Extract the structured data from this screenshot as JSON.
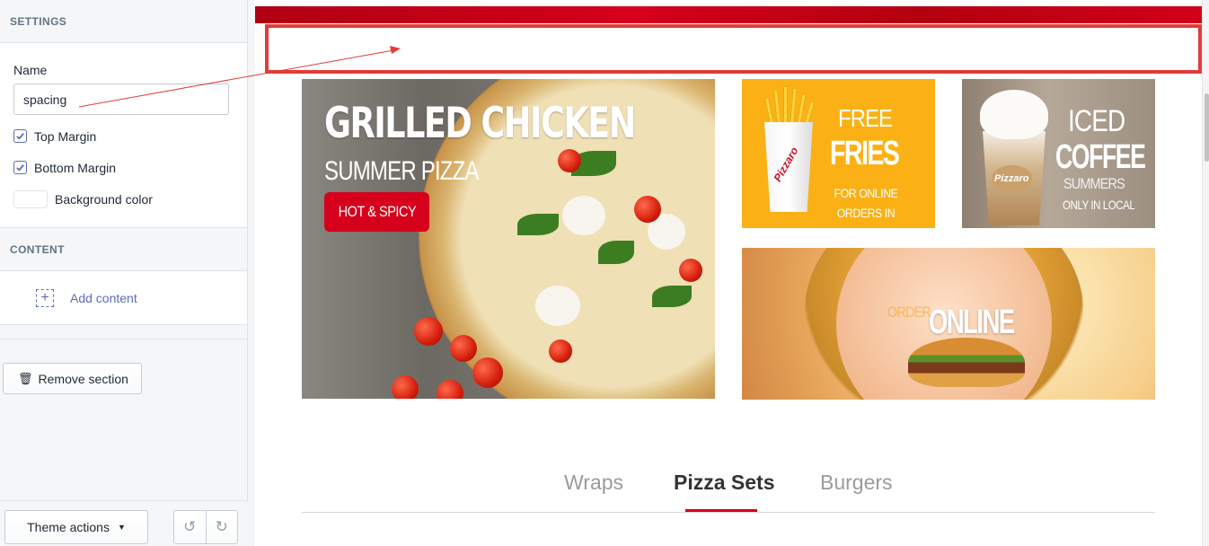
{
  "sidebar": {
    "settings_heading": "SETTINGS",
    "name_label": "Name",
    "name_value": "spacing",
    "top_margin_label": "Top Margin",
    "top_margin_checked": true,
    "bottom_margin_label": "Bottom Margin",
    "bottom_margin_checked": true,
    "bg_color_label": "Background color",
    "bg_color_value": "#ffffff",
    "content_heading": "CONTENT",
    "add_content_label": "Add content",
    "remove_section_label": "Remove section",
    "theme_actions_label": "Theme actions"
  },
  "preview": {
    "promo_main": {
      "title": "GRILLED CHICKEN",
      "subtitle": "SUMMER PIZZA",
      "button": "HOT & SPICY"
    },
    "promo_fries": {
      "line1": "FREE",
      "line2": "FRIES",
      "line3": "FOR ONLINE ORDERS IN WENSDAYS",
      "brand": "Pizzaro"
    },
    "promo_coffee": {
      "line1": "ICED",
      "line2": "COFFEE",
      "line3": "SUMMERS",
      "line4": "ONLY IN LOCAL",
      "brand": "Pizzaro"
    },
    "promo_online": {
      "line1": "ORDER",
      "line2": "ONLINE"
    },
    "tabs": [
      {
        "label": "Wraps",
        "active": false
      },
      {
        "label": "Pizza Sets",
        "active": true
      },
      {
        "label": "Burgers",
        "active": false
      }
    ]
  },
  "colors": {
    "accent": "#d6001c",
    "highlight_border": "#e23b3b",
    "link": "#5c6ac4",
    "fries_bg": "#fbb115"
  }
}
